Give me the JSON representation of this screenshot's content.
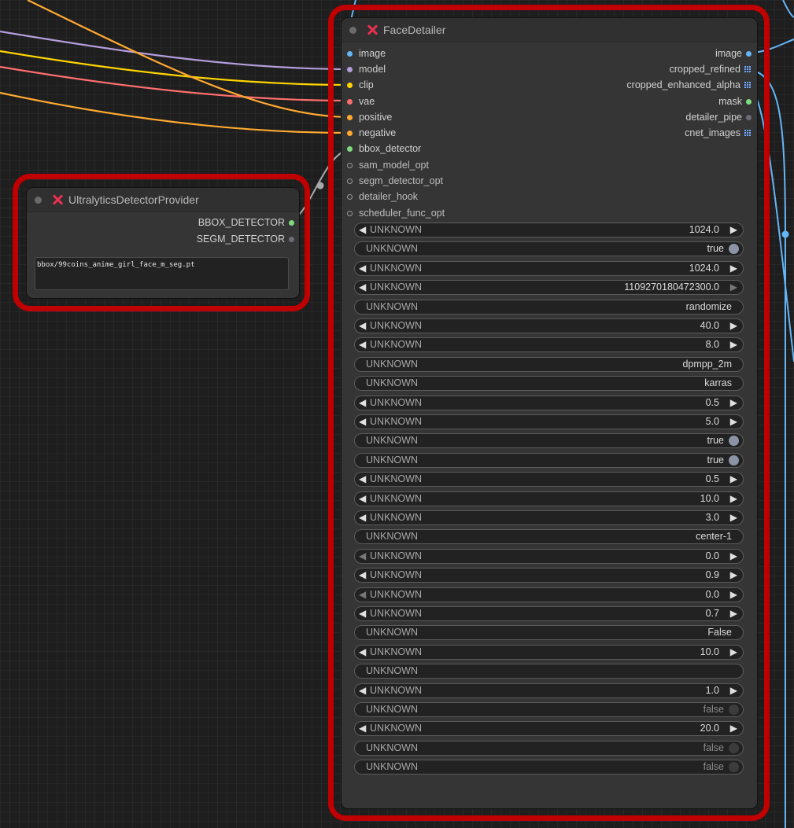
{
  "colors": {
    "frame": "#c00000",
    "image": "#64b5f6",
    "model": "#b39ddb",
    "clip": "#ffd500",
    "vae": "#ff6e6e",
    "conditioning": "#ffa931",
    "bbox": "#7ddc7d",
    "gray": "#9a9a9a"
  },
  "ultralytics": {
    "title": "UltralyticsDetectorProvider",
    "outputs": [
      "BBOX_DETECTOR",
      "SEGM_DETECTOR"
    ],
    "model_name": "bbox/99coins_anime_girl_face_m_seg.pt"
  },
  "facedetailer": {
    "title": "FaceDetailer",
    "inputs": [
      "image",
      "model",
      "clip",
      "vae",
      "positive",
      "negative",
      "bbox_detector",
      "sam_model_opt",
      "segm_detector_opt",
      "detailer_hook",
      "scheduler_func_opt"
    ],
    "outputs": [
      "image",
      "cropped_refined",
      "cropped_enhanced_alpha",
      "mask",
      "detailer_pipe",
      "cnet_images"
    ],
    "widgets": [
      {
        "kind": "number",
        "label": "UNKNOWN",
        "value": "1024.0"
      },
      {
        "kind": "toggle",
        "label": "UNKNOWN",
        "value": "true",
        "on": true
      },
      {
        "kind": "number",
        "label": "UNKNOWN",
        "value": "1024.0"
      },
      {
        "kind": "number",
        "label": "UNKNOWN",
        "value": "1109270180472300.0",
        "right_dim": true
      },
      {
        "kind": "combo",
        "label": "UNKNOWN",
        "value": "randomize"
      },
      {
        "kind": "number",
        "label": "UNKNOWN",
        "value": "40.0"
      },
      {
        "kind": "number",
        "label": "UNKNOWN",
        "value": "8.0"
      },
      {
        "kind": "combo",
        "label": "UNKNOWN",
        "value": "dpmpp_2m"
      },
      {
        "kind": "combo",
        "label": "UNKNOWN",
        "value": "karras"
      },
      {
        "kind": "number",
        "label": "UNKNOWN",
        "value": "0.5"
      },
      {
        "kind": "number",
        "label": "UNKNOWN",
        "value": "5.0"
      },
      {
        "kind": "toggle",
        "label": "UNKNOWN",
        "value": "true",
        "on": true
      },
      {
        "kind": "toggle",
        "label": "UNKNOWN",
        "value": "true",
        "on": true
      },
      {
        "kind": "number",
        "label": "UNKNOWN",
        "value": "0.5"
      },
      {
        "kind": "number",
        "label": "UNKNOWN",
        "value": "10.0"
      },
      {
        "kind": "number",
        "label": "UNKNOWN",
        "value": "3.0"
      },
      {
        "kind": "combo",
        "label": "UNKNOWN",
        "value": "center-1"
      },
      {
        "kind": "number",
        "label": "UNKNOWN",
        "value": "0.0",
        "left_dim": true
      },
      {
        "kind": "number",
        "label": "UNKNOWN",
        "value": "0.9"
      },
      {
        "kind": "number",
        "label": "UNKNOWN",
        "value": "0.0",
        "left_dim": true
      },
      {
        "kind": "number",
        "label": "UNKNOWN",
        "value": "0.7"
      },
      {
        "kind": "combo",
        "label": "UNKNOWN",
        "value": "False"
      },
      {
        "kind": "number",
        "label": "UNKNOWN",
        "value": "10.0"
      },
      {
        "kind": "combo",
        "label": "UNKNOWN",
        "value": ""
      },
      {
        "kind": "number",
        "label": "UNKNOWN",
        "value": "1.0"
      },
      {
        "kind": "toggle",
        "label": "UNKNOWN",
        "value": "false",
        "on": false
      },
      {
        "kind": "number",
        "label": "UNKNOWN",
        "value": "20.0"
      },
      {
        "kind": "toggle",
        "label": "UNKNOWN",
        "value": "false",
        "on": false
      },
      {
        "kind": "toggle",
        "label": "UNKNOWN",
        "value": "false",
        "on": false
      }
    ]
  }
}
